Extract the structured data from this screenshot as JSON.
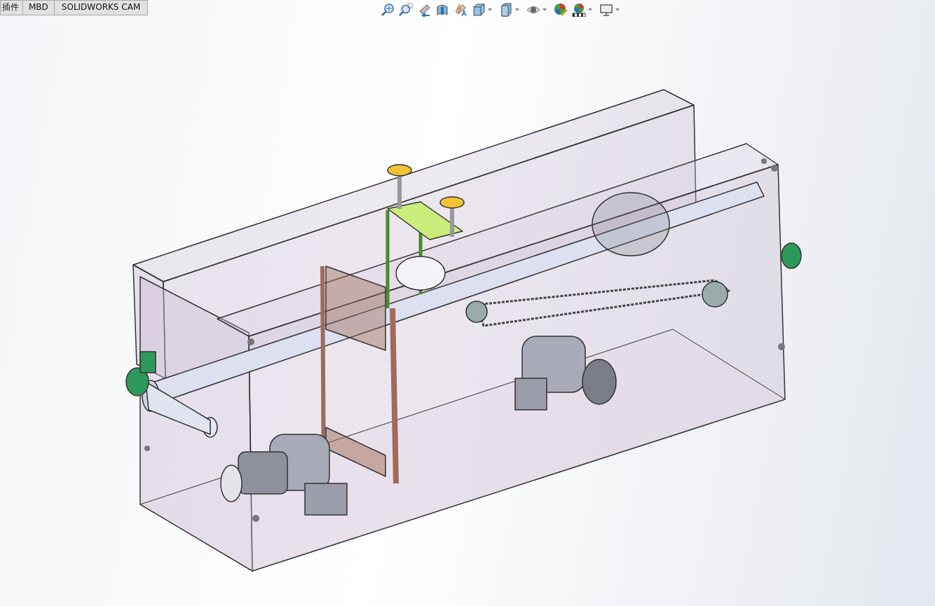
{
  "tabs": [
    {
      "label": "插件"
    },
    {
      "label": "MBD"
    },
    {
      "label": "SOLIDWORKS CAM"
    }
  ],
  "toolbar": [
    {
      "kind": "zoom-fit",
      "dropdown": false
    },
    {
      "kind": "zoom-area",
      "dropdown": false
    },
    {
      "kind": "previous-view",
      "dropdown": false
    },
    {
      "kind": "section",
      "dropdown": false
    },
    {
      "kind": "annotation",
      "dropdown": false
    },
    {
      "kind": "orientation",
      "dropdown": true
    },
    {
      "kind": "display-style",
      "dropdown": true
    },
    {
      "kind": "hide-show",
      "dropdown": true
    },
    {
      "kind": "appearance",
      "dropdown": false
    },
    {
      "kind": "scene",
      "dropdown": true
    },
    {
      "kind": "view-settings",
      "dropdown": true
    }
  ]
}
